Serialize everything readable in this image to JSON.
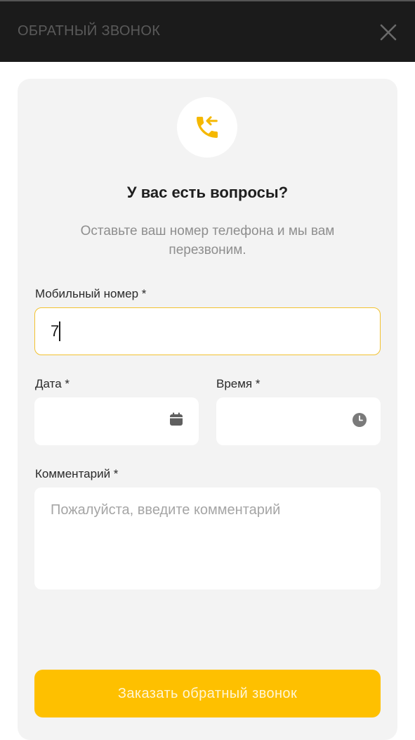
{
  "header": {
    "title": "ОБРАТНЫЙ ЗВОНОК",
    "close_icon": "close-icon"
  },
  "intro": {
    "icon": "phone-callback-icon",
    "heading": "У вас есть вопросы?",
    "subtext": "Оставьте ваш номер телефона и мы вам перезвоним."
  },
  "form": {
    "phone": {
      "label": "Мобильный номер *",
      "value": "7"
    },
    "date": {
      "label": "Дата *",
      "value": "",
      "icon": "calendar-icon"
    },
    "time": {
      "label": "Время *",
      "value": "",
      "icon": "clock-icon"
    },
    "comment": {
      "label": "Комментарий *",
      "placeholder": "Пожалуйста, введите комментарий",
      "value": ""
    },
    "submit_label": "Заказать обратный звонок"
  },
  "colors": {
    "accent": "#fec000",
    "header_bg": "#1b1b1b",
    "card_bg": "#f3f3f3",
    "focus_border": "#f2c230"
  }
}
